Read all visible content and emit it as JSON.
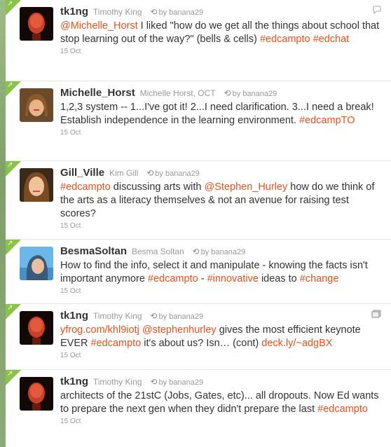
{
  "retweet_prefix": "by",
  "tweets": [
    {
      "screen_name": "tk1ng",
      "full_name": "Timothy King",
      "retweeted_by": "banana29",
      "segments": [
        {
          "t": "@Michelle_Horst",
          "hl": true
        },
        {
          "t": " I liked \"how do we get all the things about school that stop learning out of the way?\" (bells & cells) ",
          "hl": false
        },
        {
          "t": "#edcampto",
          "hl": true
        },
        {
          "t": " ",
          "hl": false
        },
        {
          "t": "#edchat",
          "hl": true
        }
      ],
      "time": "15 Oct",
      "action_icon": "reply-bubble-icon"
    },
    {
      "screen_name": "Michelle_Horst",
      "full_name": "Michelle Horst, OCT",
      "retweeted_by": "banana29",
      "segments": [
        {
          "t": "1,2,3 system -- 1...I've got it! 2...I need clarification. 3...I need a break! Establish independence in the learning environment. ",
          "hl": false
        },
        {
          "t": "#edcampTO",
          "hl": true
        }
      ],
      "time": "15 Oct"
    },
    {
      "screen_name": "Gill_Ville",
      "full_name": "Kim Gill",
      "retweeted_by": "banana29",
      "segments": [
        {
          "t": "#edcampto",
          "hl": true
        },
        {
          "t": " discussing arts with ",
          "hl": false
        },
        {
          "t": "@Stephen_Hurley",
          "hl": true
        },
        {
          "t": " how do we think of the arts as a literacy themselves & not an avenue for raising test scores?",
          "hl": false
        }
      ],
      "time": "15 Oct"
    },
    {
      "screen_name": "BesmaSoltan",
      "full_name": "Besma Soltan",
      "retweeted_by": "banana29",
      "segments": [
        {
          "t": "How to find the info, select it and manipulate - knowing the facts isn't important anymore ",
          "hl": false
        },
        {
          "t": "#edcampto",
          "hl": true
        },
        {
          "t": " - ",
          "hl": false
        },
        {
          "t": "#innovative",
          "hl": true
        },
        {
          "t": " ideas to ",
          "hl": false
        },
        {
          "t": "#change",
          "hl": true
        }
      ],
      "time": "15 Oct"
    },
    {
      "screen_name": "tk1ng",
      "full_name": "Timothy King",
      "retweeted_by": "banana29",
      "segments": [
        {
          "t": "yfrog.com/khl9iotj",
          "hl": true
        },
        {
          "t": " ",
          "hl": false
        },
        {
          "t": "@stephenhurley",
          "hl": true
        },
        {
          "t": " gives the most efficient keynote EVER ",
          "hl": false
        },
        {
          "t": "#edcampto",
          "hl": true
        },
        {
          "t": " it's about us? Isn… (cont) ",
          "hl": false
        },
        {
          "t": "deck.ly/~adgBX",
          "hl": true
        }
      ],
      "time": "15 Oct",
      "action_icon": "media-icon"
    },
    {
      "screen_name": "tk1ng",
      "full_name": "Timothy King",
      "retweeted_by": "banana29",
      "segments": [
        {
          "t": "architects of the 21stC (Jobs, Gates, etc)... all dropouts. Now Ed wants to prepare the next gen when they didn't prepare the last ",
          "hl": false
        },
        {
          "t": "#edcampto",
          "hl": true
        }
      ],
      "time": "15 Oct"
    }
  ],
  "colors": {
    "link": "#e8501c",
    "corner": "#8bc34a",
    "page_background": "#8fae7a"
  }
}
